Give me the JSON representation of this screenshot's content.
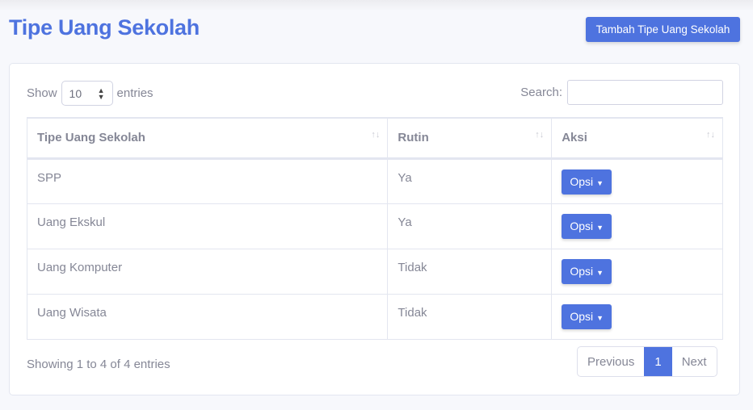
{
  "title": "Tipe Uang Sekolah",
  "add_button": "Tambah Tipe Uang Sekolah",
  "length": {
    "show": "Show",
    "value": "10",
    "entries": "entries"
  },
  "search": {
    "label": "Search:",
    "value": ""
  },
  "columns": [
    "Tipe Uang Sekolah",
    "Rutin",
    "Aksi"
  ],
  "rows": [
    {
      "tipe": "SPP",
      "rutin": "Ya",
      "aksi": "Opsi"
    },
    {
      "tipe": "Uang Ekskul",
      "rutin": "Ya",
      "aksi": "Opsi"
    },
    {
      "tipe": "Uang Komputer",
      "rutin": "Tidak",
      "aksi": "Opsi"
    },
    {
      "tipe": "Uang Wisata",
      "rutin": "Tidak",
      "aksi": "Opsi"
    }
  ],
  "info": "Showing 1 to 4 of 4 entries",
  "pagination": {
    "previous": "Previous",
    "current": "1",
    "next": "Next"
  },
  "accent": "#4e73df"
}
